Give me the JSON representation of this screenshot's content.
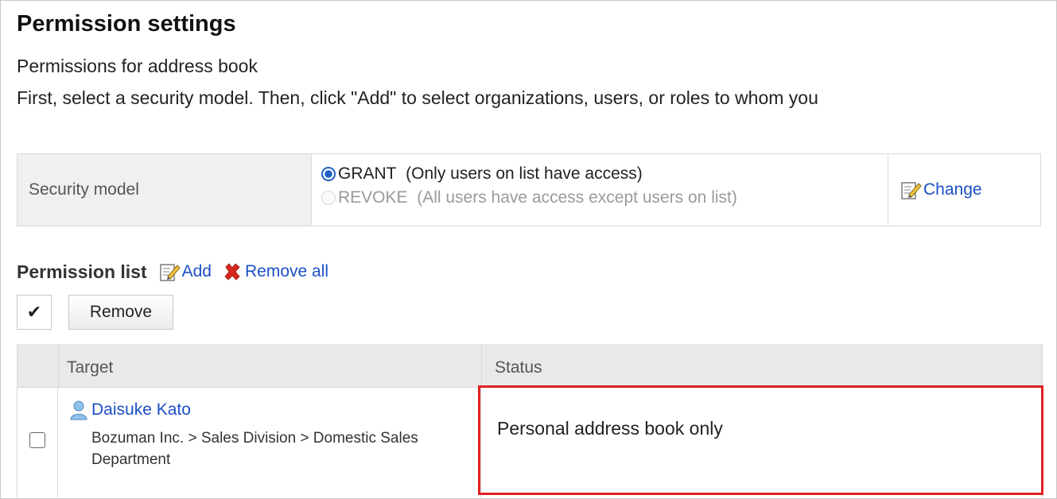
{
  "page": {
    "title": "Permission settings",
    "subtitle": "Permissions for address book",
    "description": "First, select a security model. Then, click \"Add\" to select organizations, users, or roles to whom you"
  },
  "security_model": {
    "label": "Security model",
    "options": [
      {
        "label": "GRANT  (Only users on list have access)",
        "selected": true
      },
      {
        "label": "REVOKE  (All users have access except users on list)",
        "selected": false
      }
    ],
    "change_label": "Change"
  },
  "permission_list": {
    "title": "Permission list",
    "add_label": "Add",
    "remove_all_label": "Remove all",
    "check_all_glyph": "✔",
    "remove_button_label": "Remove",
    "columns": {
      "target": "Target",
      "status": "Status"
    },
    "rows": [
      {
        "name": "Daisuke Kato",
        "org_path": "Bozuman Inc. > Sales Division > Domestic Sales Department",
        "status": "Personal address book only",
        "checked": false
      }
    ]
  },
  "colors": {
    "link": "#1a4fc4",
    "highlight": "#e02020",
    "header_bg": "#e9e9e9"
  },
  "icons": {
    "edit": "edit-icon",
    "remove": "x-icon",
    "user": "user-icon",
    "radio_selected": "radio-selected-icon"
  }
}
